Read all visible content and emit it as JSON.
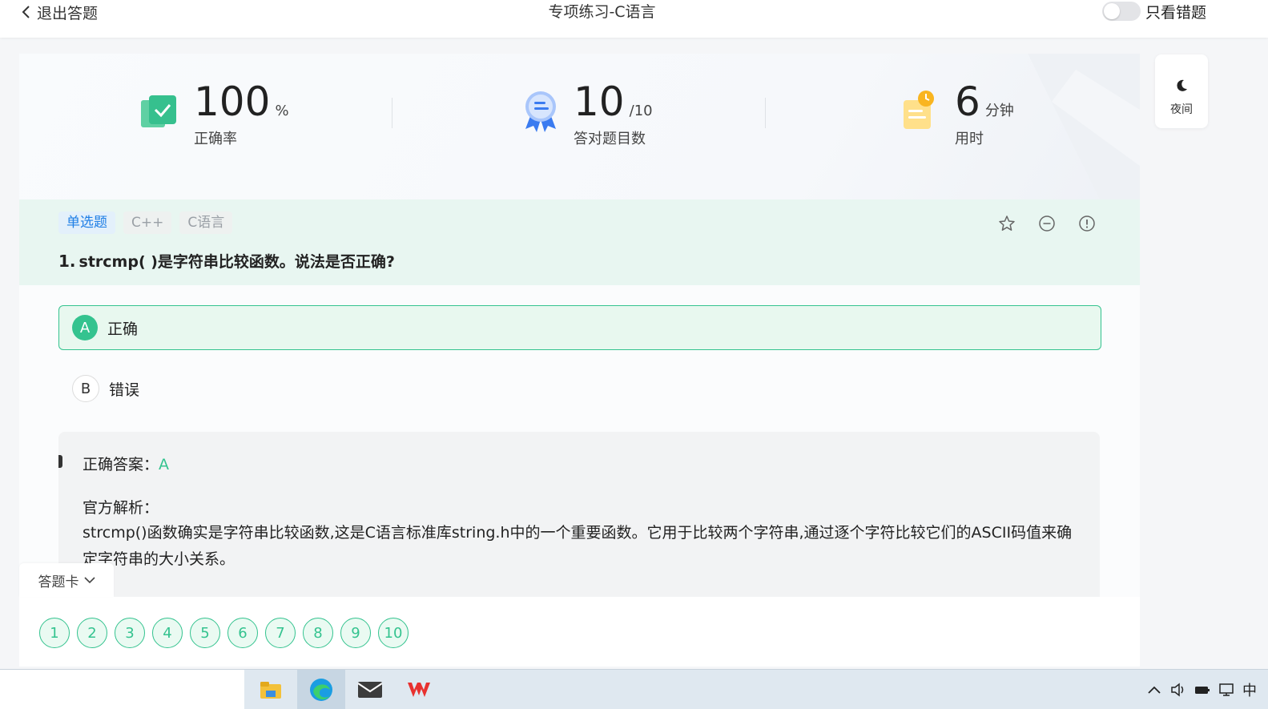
{
  "header": {
    "back_label": "退出答题",
    "title": "专项练习-C语言",
    "only_wrong_label": "只看错题"
  },
  "stats": {
    "accuracy": {
      "value": "100",
      "unit": "%",
      "label": "正确率"
    },
    "answered": {
      "value": "10",
      "unit": "/10",
      "label": "答对题目数"
    },
    "time": {
      "value": "6",
      "unit": "分钟",
      "label": "用时"
    }
  },
  "night_mode": {
    "label": "夜间"
  },
  "question": {
    "type_tag": "单选题",
    "tags": [
      "C++",
      "C语言"
    ],
    "number": "1.",
    "text": "strcmp( )是字符串比较函数。说法是否正确?",
    "options": [
      {
        "letter": "A",
        "text": "正确",
        "selected": true
      },
      {
        "letter": "B",
        "text": "错误",
        "selected": false
      }
    ]
  },
  "analysis": {
    "answer_label": "正确答案：",
    "answer_value": "A",
    "explanation_title": "官方解析：",
    "explanation_text": "strcmp()函数确实是字符串比较函数,这是C语言标准库string.h中的一个重要函数。它用于比较两个字符串,通过逐个字符比较它们的ASCII码值来确定字符串的大小关系。"
  },
  "answer_sheet": {
    "label": "答题卡",
    "numbers": [
      "1",
      "2",
      "3",
      "4",
      "5",
      "6",
      "7",
      "8",
      "9",
      "10"
    ]
  },
  "taskbar": {
    "tray_ime": "中"
  },
  "colors": {
    "accent_green": "#34c38f",
    "tag_blue": "#1f7fe6",
    "question_bg": "#e8f6f1"
  }
}
